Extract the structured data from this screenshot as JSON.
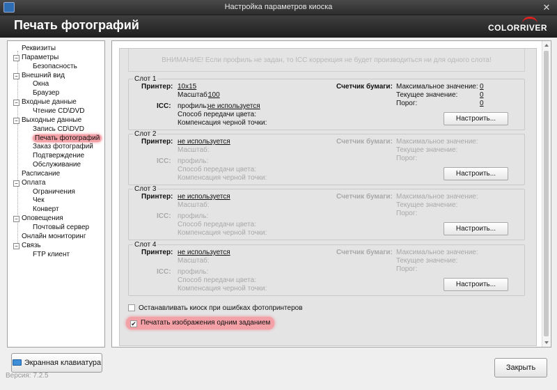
{
  "window": {
    "title": "Настройка параметров киоска",
    "close_glyph": "✕"
  },
  "header": {
    "page_title": "Печать фотографий",
    "logo": "COLORRIVER"
  },
  "tree": [
    {
      "label": "Реквизиты",
      "level": 0,
      "expander": ""
    },
    {
      "label": "Параметры",
      "level": 0,
      "expander": "−"
    },
    {
      "label": "Безопасность",
      "level": 1,
      "expander": ""
    },
    {
      "label": "Внешний вид",
      "level": 0,
      "expander": "−"
    },
    {
      "label": "Окна",
      "level": 1,
      "expander": ""
    },
    {
      "label": "Браузер",
      "level": 1,
      "expander": ""
    },
    {
      "label": "Входные данные",
      "level": 0,
      "expander": "−"
    },
    {
      "label": "Чтение CD\\DVD",
      "level": 1,
      "expander": ""
    },
    {
      "label": "Выходные данные",
      "level": 0,
      "expander": "−"
    },
    {
      "label": "Запись CD\\DVD",
      "level": 1,
      "expander": ""
    },
    {
      "label": "Печать фотографий",
      "level": 1,
      "expander": "",
      "selected": true
    },
    {
      "label": "Заказ фотографий",
      "level": 1,
      "expander": ""
    },
    {
      "label": "Подтверждение",
      "level": 1,
      "expander": ""
    },
    {
      "label": "Обслуживание",
      "level": 1,
      "expander": ""
    },
    {
      "label": "Расписание",
      "level": 0,
      "expander": ""
    },
    {
      "label": "Оплата",
      "level": 0,
      "expander": "−"
    },
    {
      "label": "Ограничения",
      "level": 1,
      "expander": ""
    },
    {
      "label": "Чек",
      "level": 1,
      "expander": ""
    },
    {
      "label": "Конверт",
      "level": 1,
      "expander": ""
    },
    {
      "label": "Оповещения",
      "level": 0,
      "expander": "−"
    },
    {
      "label": "Почтовый сервер",
      "level": 1,
      "expander": ""
    },
    {
      "label": "Онлайн мониторинг",
      "level": 0,
      "expander": ""
    },
    {
      "label": "Связь",
      "level": 0,
      "expander": "−"
    },
    {
      "label": "FTP клиент",
      "level": 1,
      "expander": ""
    }
  ],
  "warning": "ВНИМАНИЕ! Если профиль не задан, то ICC коррекция не будет производиться ни для одного слота!",
  "labels": {
    "printer": "Принтер:",
    "scale": "Масштаб:",
    "icc": "ICC:",
    "profile": "профиль:",
    "color_method": "Способ передачи цвета:",
    "black_comp": "Компенсация черной точки:",
    "paper_counter": "Счетчик бумаги:",
    "max_value": "Максимальное значение:",
    "current_value": "Текущее значение:",
    "threshold": "Порог:",
    "configure": "Настроить..."
  },
  "slots": [
    {
      "title": "Слот 1",
      "printer": "10x15",
      "scale": "100",
      "profile": "не используется",
      "max": "0",
      "current": "0",
      "threshold": "0",
      "enabled": true
    },
    {
      "title": "Слот 2",
      "printer": "не используется",
      "scale": "",
      "profile": "",
      "max": "",
      "current": "",
      "threshold": "",
      "enabled": false
    },
    {
      "title": "Слот 3",
      "printer": "не используется",
      "scale": "",
      "profile": "",
      "max": "",
      "current": "",
      "threshold": "",
      "enabled": false
    },
    {
      "title": "Слот 4",
      "printer": "не используется",
      "scale": "",
      "profile": "",
      "max": "",
      "current": "",
      "threshold": "",
      "enabled": false
    }
  ],
  "options": {
    "stop_on_error": {
      "label": "Останавливать киоск при ошибках фотопринтеров",
      "checked": false,
      "glyph": ""
    },
    "print_single_job": {
      "label": "Печатать изображения одним заданием",
      "checked": true,
      "glyph": "✔"
    }
  },
  "footer": {
    "keyboard_button": "Экранная клавиатура",
    "version": "Версия: 7.2.5",
    "close_button": "Закрыть"
  }
}
